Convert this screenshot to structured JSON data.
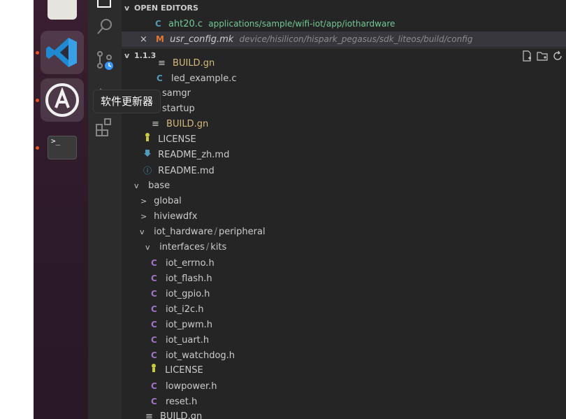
{
  "tooltip": "软件更新器",
  "open_editors": {
    "title": "OPEN EDITORS",
    "items": [
      {
        "icon": "C",
        "name": "aht20.c",
        "path": "applications/sample/wifi-iot/app/iothardware"
      },
      {
        "close": "×",
        "icon": "M",
        "name": "usr_config.mk",
        "path": "device/hisilicon/hispark_pegasus/sdk_liteos/build/config"
      }
    ]
  },
  "folder": {
    "title": "1.1.3"
  },
  "tree": [
    {
      "label": "BUILD.gn",
      "icon": "≡"
    },
    {
      "label": "led_example.c",
      "icon": "C"
    },
    {
      "label": "samgr"
    },
    {
      "label": "startup"
    },
    {
      "label": "BUILD.gn",
      "icon": "≡"
    },
    {
      "label": "LICENSE",
      "icon": "license"
    },
    {
      "label": "README_zh.md",
      "icon": "download"
    },
    {
      "label": "README.md",
      "icon": "ⓘ"
    },
    {
      "label": "base",
      "chev": "v"
    },
    {
      "label": "global",
      "chev": ">"
    },
    {
      "label": "hiviewdfx",
      "chev": ">"
    },
    {
      "label": "iot_hardware",
      "label2": "peripheral",
      "sep": "/",
      "chev": "v"
    },
    {
      "label": "interfaces",
      "label2": "kits",
      "sep": "/",
      "chev": "v"
    },
    {
      "label": "iot_errno.h",
      "icon": "C"
    },
    {
      "label": "iot_flash.h",
      "icon": "C"
    },
    {
      "label": "iot_gpio.h",
      "icon": "C"
    },
    {
      "label": "iot_i2c.h",
      "icon": "C"
    },
    {
      "label": "iot_pwm.h",
      "icon": "C"
    },
    {
      "label": "iot_uart.h",
      "icon": "C"
    },
    {
      "label": "iot_watchdog.h",
      "icon": "C"
    },
    {
      "label": "LICENSE",
      "icon": "license"
    },
    {
      "label": "lowpower.h",
      "icon": "C"
    },
    {
      "label": "reset.h",
      "icon": "C"
    },
    {
      "label": "BUILD.gn",
      "icon": "≡"
    }
  ]
}
